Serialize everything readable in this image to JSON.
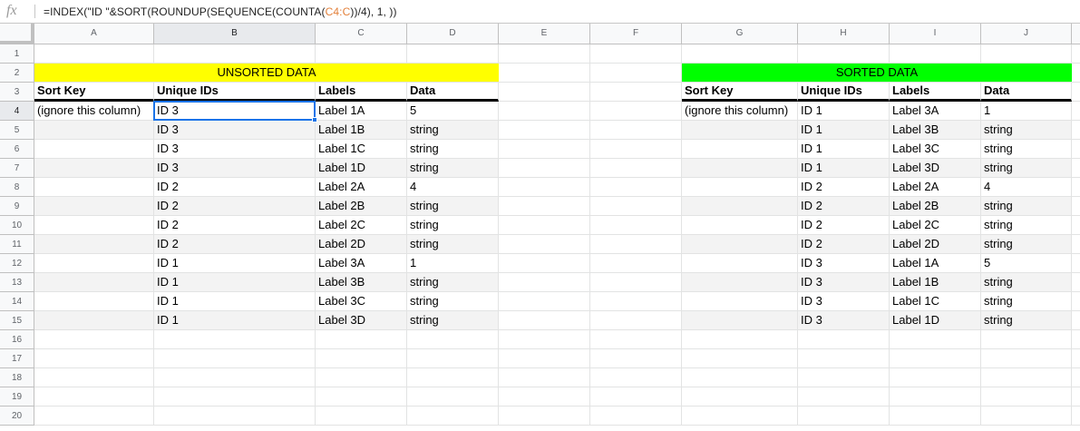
{
  "formula_bar": {
    "fx_label": "fx",
    "parts": [
      {
        "text": "=INDEX(\"ID \"&SORT(ROUNDUP(SEQUENCE(COUNTA(",
        "ref": false
      },
      {
        "text": "C4:C",
        "ref": true
      },
      {
        "text": "))/4), 1, ))",
        "ref": false
      }
    ]
  },
  "columns": [
    "A",
    "B",
    "C",
    "D",
    "E",
    "F",
    "G",
    "H",
    "I",
    "J"
  ],
  "selected_column": "B",
  "rows": [
    "1",
    "2",
    "3",
    "4",
    "5",
    "6",
    "7",
    "8",
    "9",
    "10",
    "11",
    "12",
    "13",
    "14",
    "15",
    "16",
    "17",
    "18",
    "19",
    "20"
  ],
  "selected_row": "4",
  "unsorted": {
    "title": "UNSORTED DATA",
    "title_color": "#ffff00",
    "headers": [
      "Sort Key",
      "Unique IDs",
      "Labels",
      "Data"
    ],
    "rows": [
      [
        "(ignore this column)",
        "ID 3",
        "Label 1A",
        "5"
      ],
      [
        "",
        "ID 3",
        "Label 1B",
        "string"
      ],
      [
        "",
        "ID 3",
        "Label 1C",
        "string"
      ],
      [
        "",
        "ID 3",
        "Label 1D",
        "string"
      ],
      [
        "",
        "ID 2",
        "Label 2A",
        "4"
      ],
      [
        "",
        "ID 2",
        "Label 2B",
        "string"
      ],
      [
        "",
        "ID 2",
        "Label 2C",
        "string"
      ],
      [
        "",
        "ID 2",
        "Label 2D",
        "string"
      ],
      [
        "",
        "ID 1",
        "Label 3A",
        "1"
      ],
      [
        "",
        "ID 1",
        "Label 3B",
        "string"
      ],
      [
        "",
        "ID 1",
        "Label 3C",
        "string"
      ],
      [
        "",
        "ID 1",
        "Label 3D",
        "string"
      ]
    ]
  },
  "sorted": {
    "title": "SORTED DATA",
    "title_color": "#00ff00",
    "headers": [
      "Sort Key",
      "Unique IDs",
      "Labels",
      "Data"
    ],
    "rows": [
      [
        "(ignore this column)",
        "ID 1",
        "Label 3A",
        "1"
      ],
      [
        "",
        "ID 1",
        "Label 3B",
        "string"
      ],
      [
        "",
        "ID 1",
        "Label 3C",
        "string"
      ],
      [
        "",
        "ID 1",
        "Label 3D",
        "string"
      ],
      [
        "",
        "ID 2",
        "Label 2A",
        "4"
      ],
      [
        "",
        "ID 2",
        "Label 2B",
        "string"
      ],
      [
        "",
        "ID 2",
        "Label 2C",
        "string"
      ],
      [
        "",
        "ID 2",
        "Label 2D",
        "string"
      ],
      [
        "",
        "ID 3",
        "Label 1A",
        "5"
      ],
      [
        "",
        "ID 3",
        "Label 1B",
        "string"
      ],
      [
        "",
        "ID 3",
        "Label 1C",
        "string"
      ],
      [
        "",
        "ID 3",
        "Label 1D",
        "string"
      ]
    ]
  },
  "colors": {
    "band": "#f3f3f3",
    "selection": "#1a73e8",
    "formula_ref": "#e3803a"
  }
}
